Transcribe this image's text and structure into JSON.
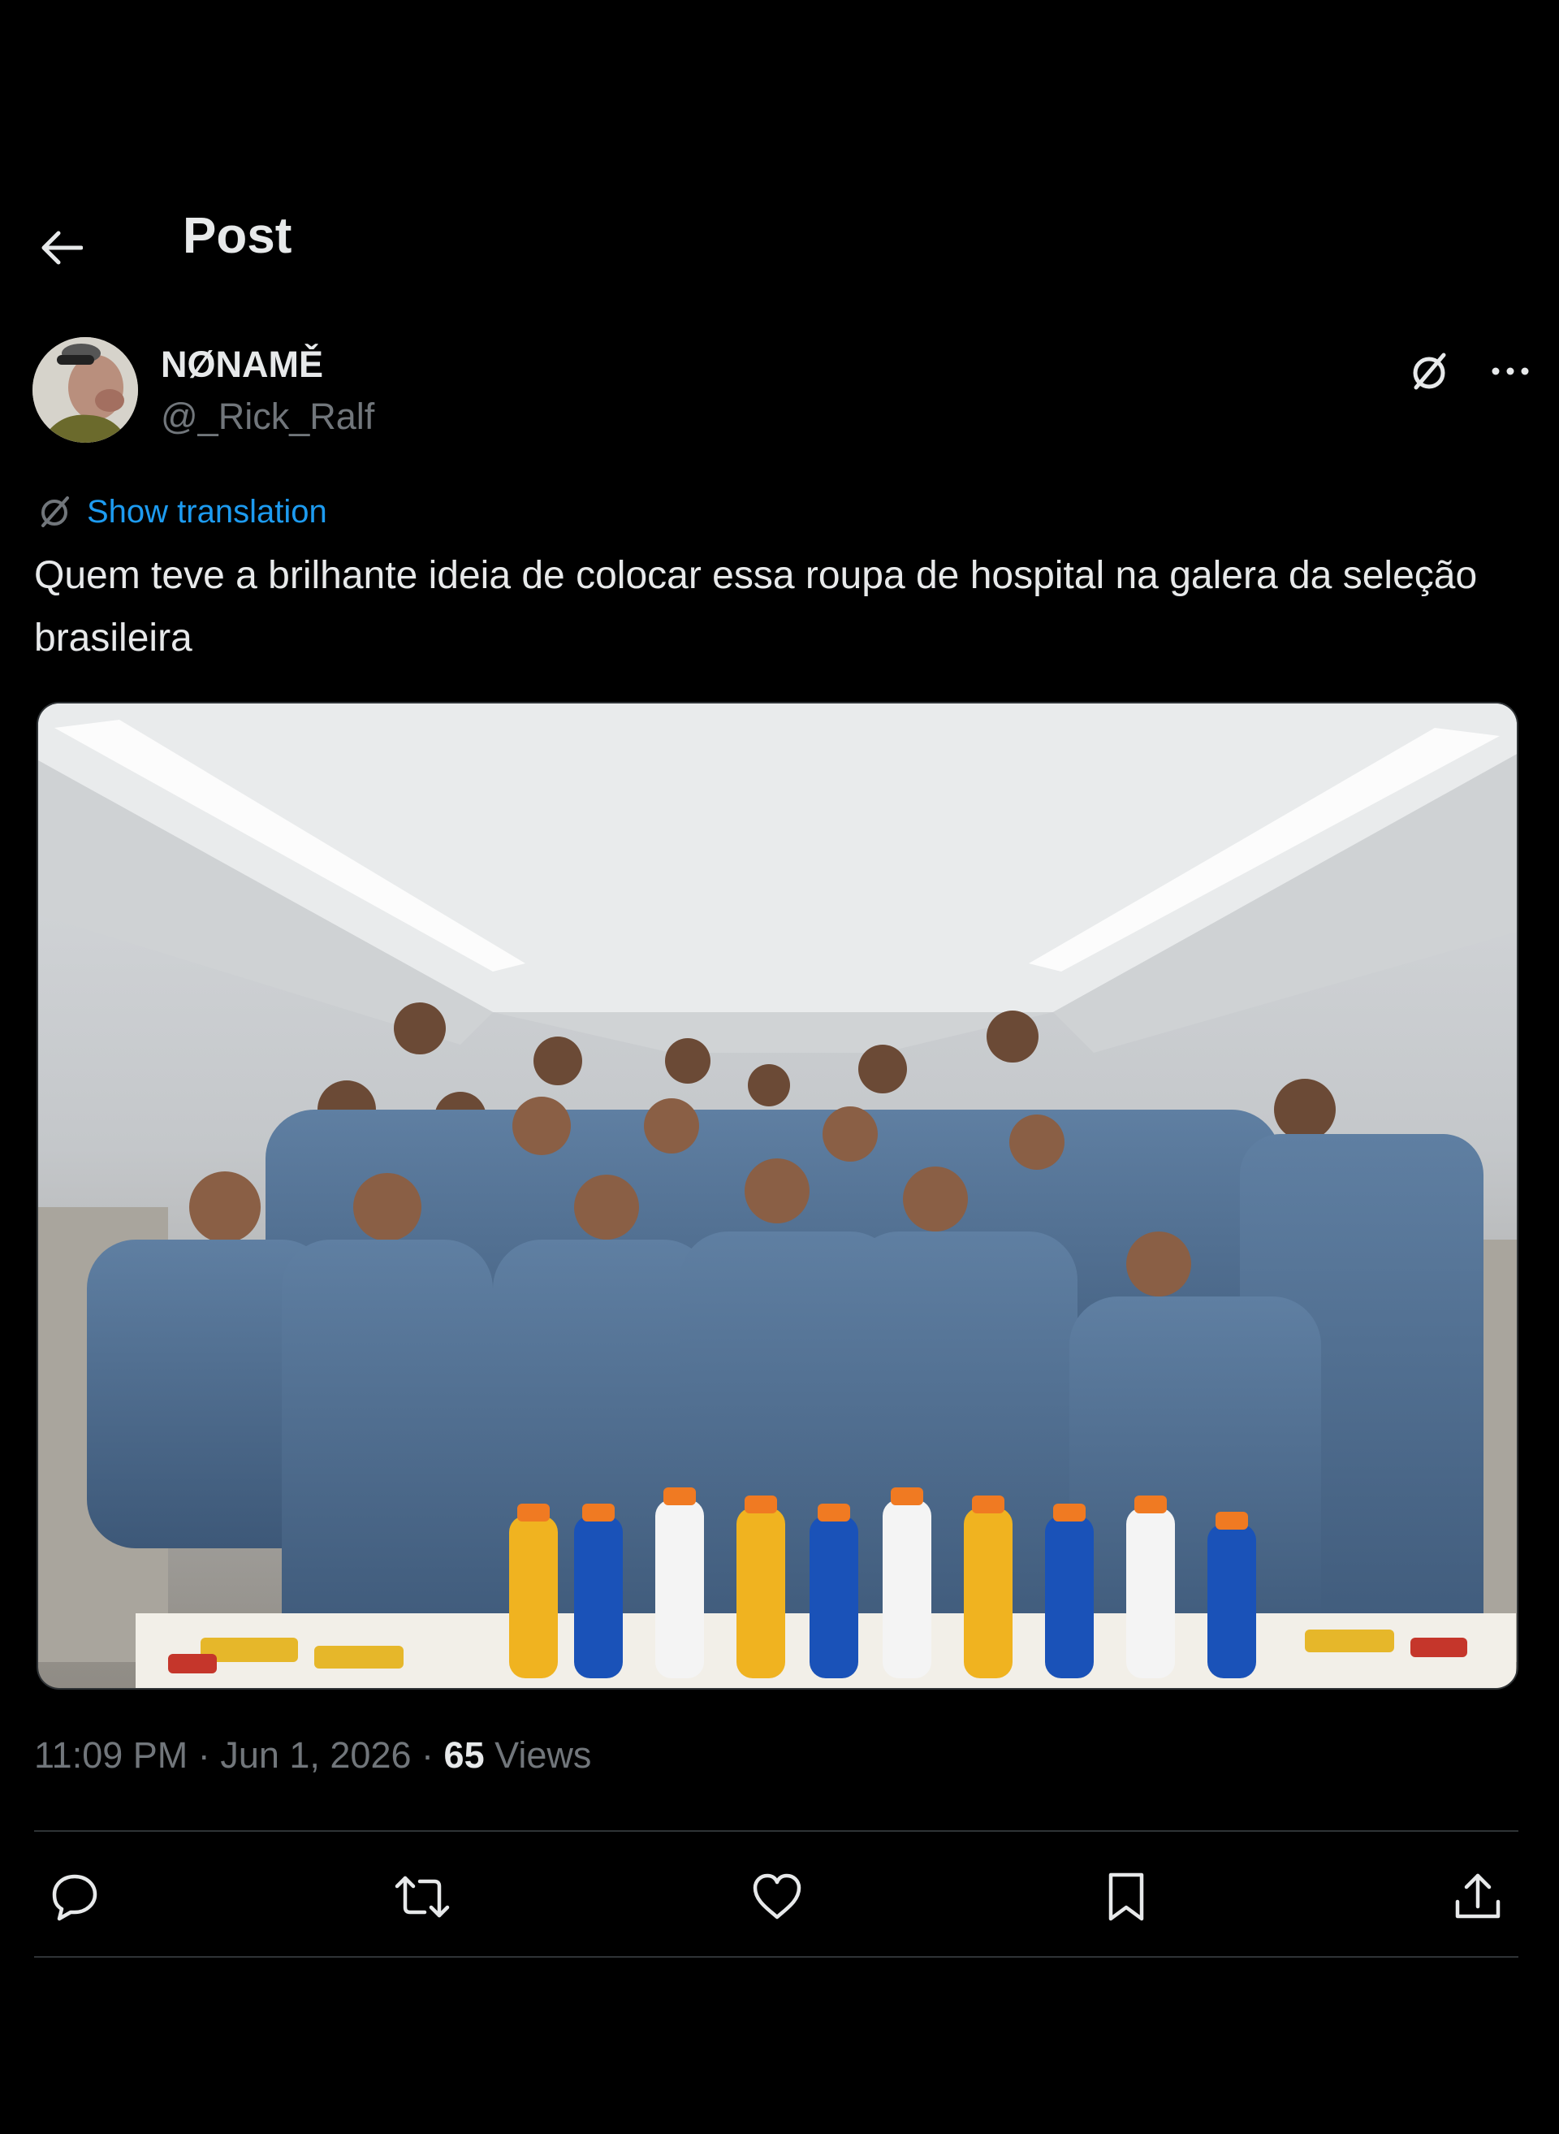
{
  "header": {
    "title": "Post"
  },
  "post": {
    "author": {
      "display_name": "NØNAMĚ",
      "handle": "@_Rick_Ralf"
    },
    "translation_label": "Show translation",
    "text": "Quem teve a brilhante ideia de colocar essa roupa de hospital na galera da seleção brasileira",
    "media": {
      "kind": "photo",
      "icon": "photo"
    },
    "meta": {
      "time": "11:09 PM",
      "separator": "·",
      "date": "Jun 1, 2026",
      "views_count": "65",
      "views_label": "Views"
    }
  },
  "actions": [
    {
      "name": "reply",
      "icon": "reply-icon"
    },
    {
      "name": "repost",
      "icon": "repost-icon"
    },
    {
      "name": "like",
      "icon": "heart-icon"
    },
    {
      "name": "bookmark",
      "icon": "bookmark-icon"
    },
    {
      "name": "share",
      "icon": "share-icon"
    }
  ],
  "colors": {
    "background": "#000000",
    "text": "#e7e9ea",
    "muted": "#71767b",
    "link": "#1d9bf0",
    "divider": "#2f3336"
  }
}
